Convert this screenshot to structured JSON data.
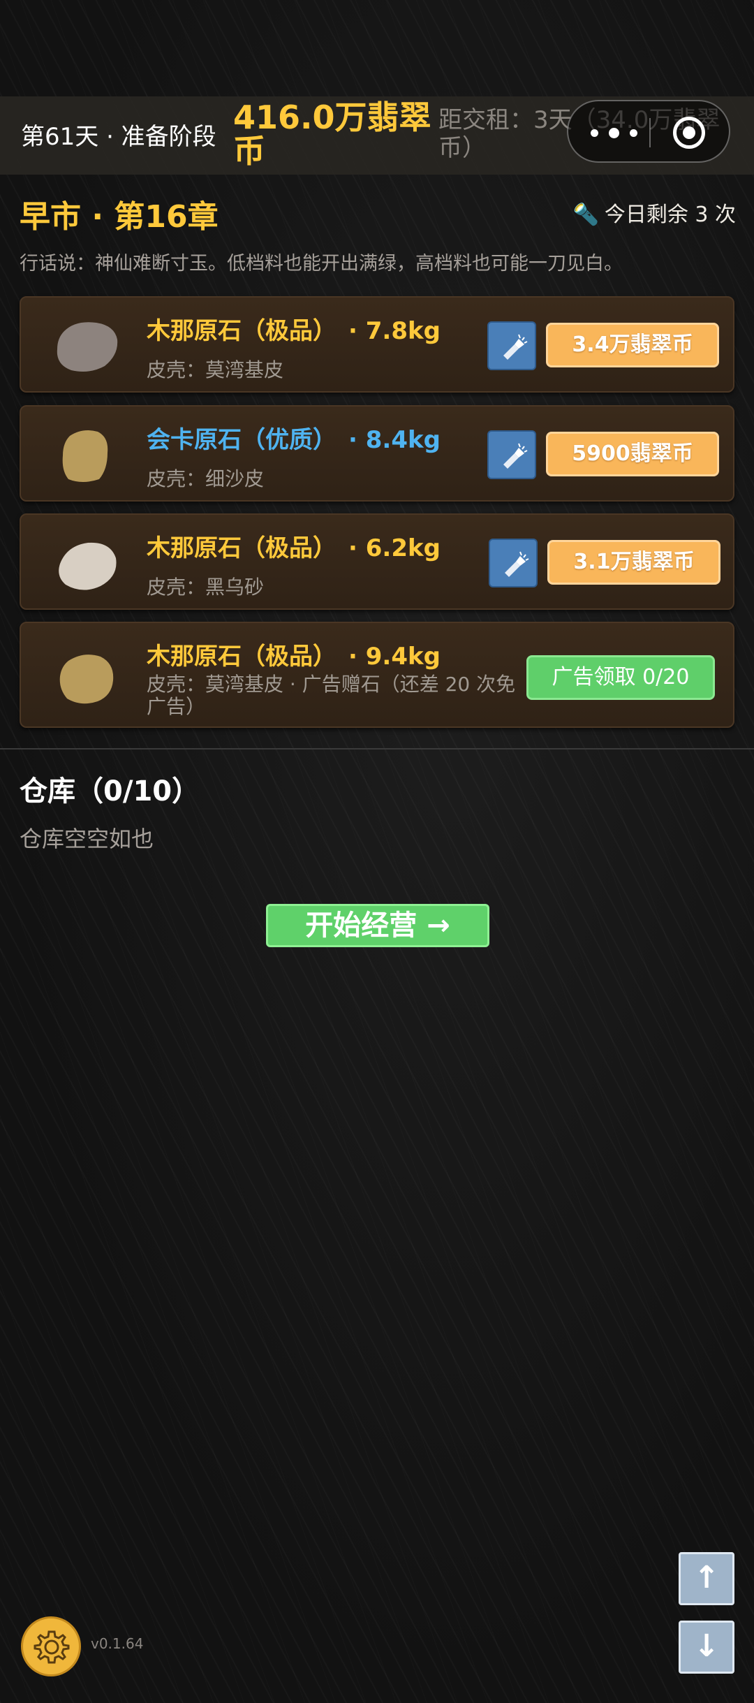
{
  "topbar": {
    "day_phase": "第61天 · 准备阶段",
    "money": "416.0万翡翠币",
    "rent": "距交租：3天（34.0万翡翠币）"
  },
  "market": {
    "title": "早市 · 第16章",
    "remaining": "今日剩余 3 次",
    "saying": "行话说：神仙难断寸玉。低档料也能开出满绿，高档料也可能一刀见白。"
  },
  "stones": [
    {
      "name": "木那原石（极品）　· 7.8kg",
      "skin": "皮壳：莫湾基皮",
      "price": "3.4万翡翠币",
      "name_color": "#ffc93b",
      "stone_color": "#8d837e"
    },
    {
      "name": "会卡原石（优质）　· 8.4kg",
      "skin": "皮壳：细沙皮",
      "price": "5900翡翠币",
      "name_color": "#4fb3f0",
      "stone_color": "#b99c5c"
    },
    {
      "name": "木那原石（极品）　· 6.2kg",
      "skin": "皮壳：黑乌砂",
      "price": "3.1万翡翠币",
      "name_color": "#ffc93b",
      "stone_color": "#d8cfc3"
    },
    {
      "name": "木那原石（极品）　· 9.4kg",
      "skin": "皮壳：莫湾基皮 · 广告赠石（还差 20 次免广告）",
      "ad_button": "广告领取 0/20",
      "name_color": "#ffc93b",
      "stone_color": "#b99c5c"
    }
  ],
  "warehouse": {
    "title": "仓库（0/10）",
    "empty_text": "仓库空空如也"
  },
  "start_button": "开始经营 →",
  "scroll_up": "↑",
  "scroll_down": "↓",
  "version": "v0.1.64",
  "icons": [
    "more-dots-icon",
    "target-icon",
    "flashlight-icon",
    "gear-icon",
    "arrow-up-icon",
    "arrow-down-icon"
  ]
}
